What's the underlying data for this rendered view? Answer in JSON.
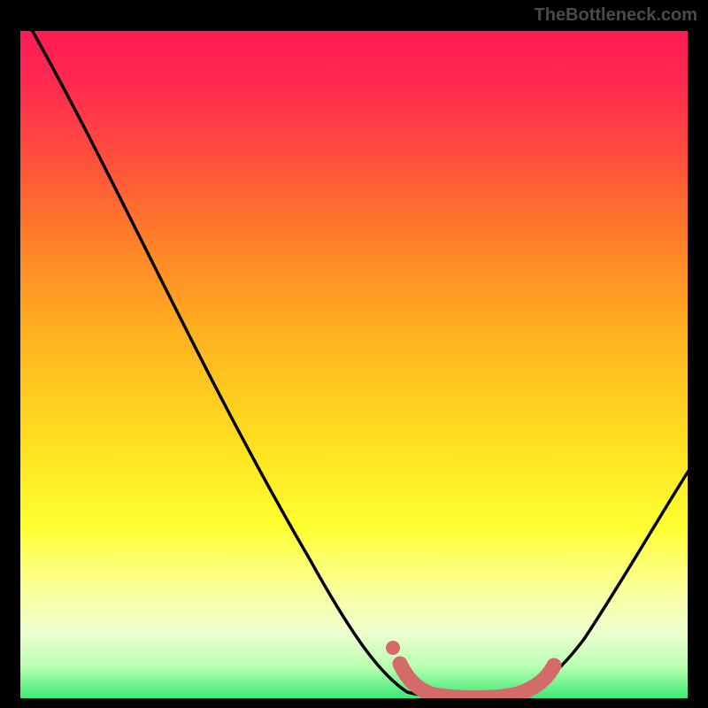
{
  "watermark": "TheBottleneck.com",
  "chart_data": {
    "type": "line",
    "title": "",
    "xlabel": "",
    "ylabel": "",
    "xlim": [
      0,
      100
    ],
    "ylim": [
      0,
      100
    ],
    "background_gradient": {
      "top": "#ff1a55",
      "bottom": "#30e870",
      "meaning": "red=high bottleneck, green=low bottleneck"
    },
    "series": [
      {
        "name": "bottleneck-curve",
        "color": "#000000",
        "x": [
          2,
          10,
          20,
          30,
          40,
          50,
          56,
          60,
          66,
          70,
          76,
          82,
          90,
          100
        ],
        "y": [
          100,
          86,
          70,
          54,
          38,
          22,
          10,
          4,
          0,
          0,
          0,
          4,
          14,
          32
        ]
      },
      {
        "name": "optimal-band",
        "color": "#d46a6a",
        "style": "thick-rounded",
        "x": [
          56,
          60,
          66,
          70,
          76,
          79
        ],
        "y": [
          5,
          1,
          0,
          0,
          1,
          5
        ]
      }
    ],
    "optimal_range_x": [
      60,
      78
    ]
  }
}
